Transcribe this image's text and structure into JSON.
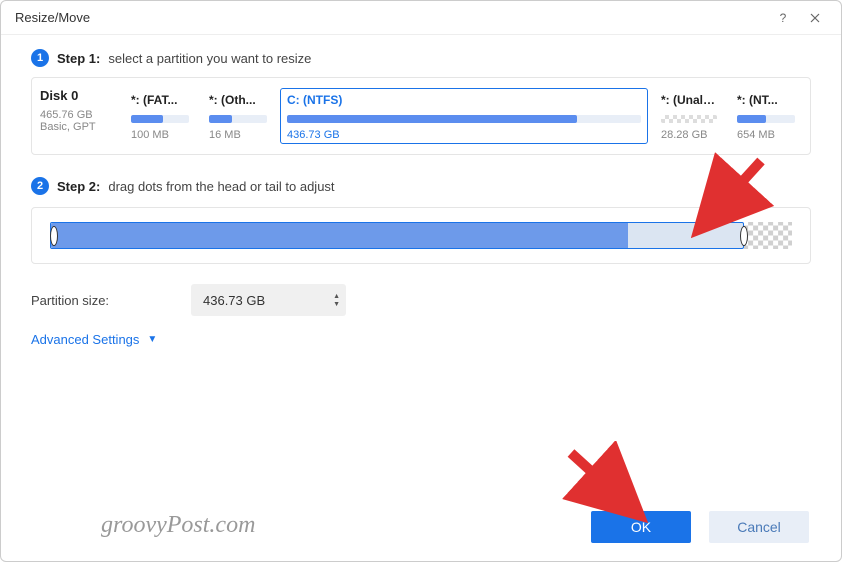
{
  "window": {
    "title": "Resize/Move"
  },
  "step1": {
    "label": "Step 1:",
    "desc": "select a partition you want to resize"
  },
  "disk": {
    "name": "Disk 0",
    "size": "465.76 GB",
    "type": "Basic, GPT"
  },
  "partitions": [
    {
      "name": "*: (FAT...",
      "size": "100 MB",
      "fillPct": 55
    },
    {
      "name": "*: (Oth...",
      "size": "16 MB",
      "fillPct": 40
    },
    {
      "name": "C: (NTFS)",
      "size": "436.73 GB",
      "fillPct": 82
    },
    {
      "name": "*: (Unallo...",
      "size": "28.28 GB",
      "unalloc": true
    },
    {
      "name": "*: (NT...",
      "size": "654 MB",
      "fillPct": 50
    }
  ],
  "step2": {
    "label": "Step 2:",
    "desc": "drag dots from the head or tail to adjust"
  },
  "slider": {
    "rangePct": 93.5,
    "fillPct": 78
  },
  "size": {
    "label": "Partition size:",
    "value": "436.73 GB"
  },
  "advanced": {
    "label": "Advanced Settings"
  },
  "buttons": {
    "ok": "OK",
    "cancel": "Cancel"
  },
  "watermark": "groovyPost.com"
}
